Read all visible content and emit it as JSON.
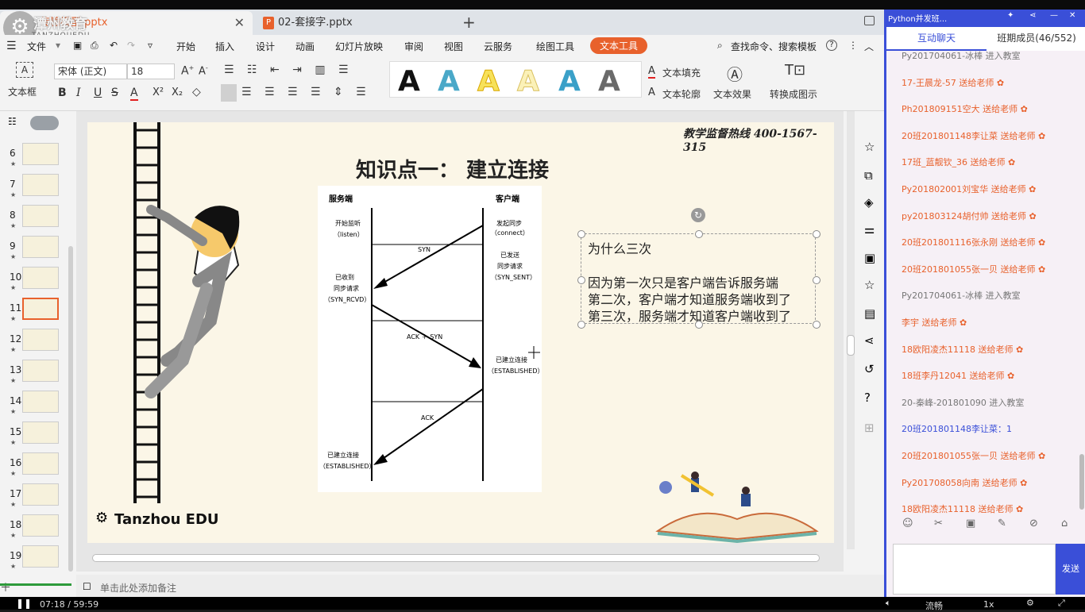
{
  "tabs": {
    "active": "传输模型.pptx",
    "inactive": "02-套接字.pptx",
    "ppt_badge": "P",
    "watermark": "潭州教育",
    "watermark_en": "TANZHOUEDU"
  },
  "menu": {
    "file": "文件",
    "items": [
      "开始",
      "插入",
      "设计",
      "动画",
      "幻灯片放映",
      "审阅",
      "视图",
      "云服务",
      "绘图工具"
    ],
    "active": "文本工具",
    "search": "查找命令、搜索模板"
  },
  "ribbon": {
    "textbox": "文本框",
    "font": "宋体 (正文)",
    "size": "18",
    "fill": "文本填充",
    "outline": "文本轮廓",
    "effect": "文本效果",
    "convert": "转换成图示"
  },
  "slides": {
    "numbers": [
      "6",
      "7",
      "8",
      "9",
      "10",
      "11",
      "12",
      "13",
      "14",
      "15",
      "16",
      "17",
      "18",
      "19"
    ],
    "selected": "11",
    "star": "★"
  },
  "slide": {
    "hotline": "教学监督热线 400-1567-315",
    "title": "知识点一： 建立连接",
    "server": "服务端",
    "client": "客户端",
    "s_listen": "开始监听",
    "s_listen2": "（listen）",
    "c_connect": "发起同步",
    "c_connect2": "（connect）",
    "syn": "SYN",
    "c_sent1": "已发送",
    "c_sent2": "同步请求",
    "c_sent3": "（SYN_SENT）",
    "s_rcvd1": "已收到",
    "s_rcvd2": "同步请求",
    "s_rcvd3": "（SYN_RCVD）",
    "ack_syn": "ACK ＋ SYN",
    "c_est1": "已建立连接",
    "c_est2": "（ESTABLISHED）",
    "ack": "ACK",
    "s_est1": "已建立连接",
    "s_est2": "（ESTABLISHED）",
    "q_title": "为什么三次",
    "q_line1": "因为第一次只是客户端告诉服务端",
    "q_line2": "第二次，客户端才知道服务端收到了",
    "q_line3": "第三次，服务端才知道客户端收到了",
    "brand": "Tanzhou EDU"
  },
  "notes": "单击此处添加备注",
  "chat": {
    "header": "Python并发班...",
    "tab1": "互动聊天",
    "tab2": "班期成员(46/552)",
    "messages": [
      {
        "text": "Py201704061-冰棒 进入教室",
        "style": "grey"
      },
      {
        "text": "17-王晨龙-57 送给老师",
        "style": "orange"
      },
      {
        "text": "Ph201809151空大 送给老师",
        "style": "orange"
      },
      {
        "text": "20班201801148李让菜 送给老师",
        "style": "orange"
      },
      {
        "text": "17班_蓝靓钦_36 送给老师",
        "style": "orange"
      },
      {
        "text": "Py201802001刘宝华 送给老师",
        "style": "orange"
      },
      {
        "text": "py201803124胡付帅 送给老师",
        "style": "orange"
      },
      {
        "text": "20班201801116张永刚 送给老师",
        "style": "orange"
      },
      {
        "text": "20班201801055张一贝 送给老师",
        "style": "orange"
      },
      {
        "text": "Py201704061-冰棒 进入教室",
        "style": "grey"
      },
      {
        "text": "李宇 送给老师",
        "style": "orange"
      },
      {
        "text": "18欧阳凌杰11118 送给老师",
        "style": "orange"
      },
      {
        "text": "18班李丹12041 送给老师",
        "style": "orange"
      },
      {
        "text": "20-秦峰-201801090 进入教室",
        "style": "grey"
      },
      {
        "text": "20班201801148李让菜：1",
        "style": "blue"
      },
      {
        "text": "20班201801055张一贝 送给老师",
        "style": "orange"
      },
      {
        "text": "Py201708058向南 送给老师",
        "style": "orange"
      },
      {
        "text": "18欧阳凌杰11118 送给老师",
        "style": "orange"
      }
    ],
    "send": "发送"
  },
  "player": {
    "time": "07:18 / 59:59",
    "quality": "流畅",
    "speed": "1x"
  }
}
